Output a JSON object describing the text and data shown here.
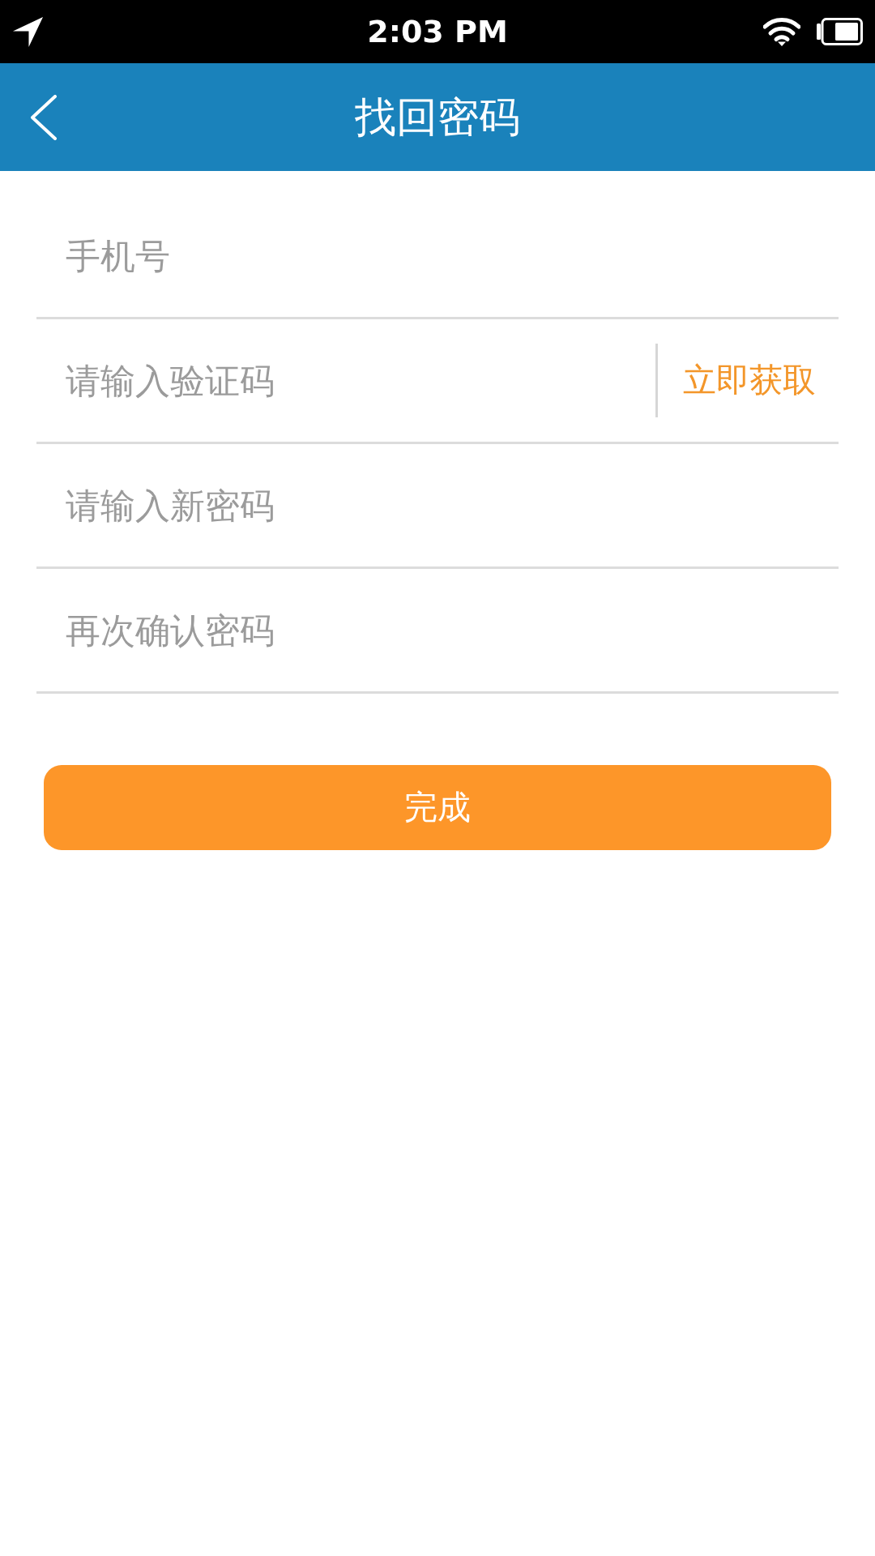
{
  "status_bar": {
    "time": "2:03 PM"
  },
  "header": {
    "title": "找回密码"
  },
  "form": {
    "fields": [
      {
        "kind": "plain",
        "placeholder": "手机号"
      },
      {
        "kind": "with_action",
        "placeholder": "请输入验证码",
        "action": "立即获取"
      },
      {
        "kind": "plain",
        "placeholder": "请输入新密码"
      },
      {
        "kind": "plain",
        "placeholder": "再次确认密码"
      }
    ]
  },
  "submit_button": {
    "label": "完成"
  }
}
